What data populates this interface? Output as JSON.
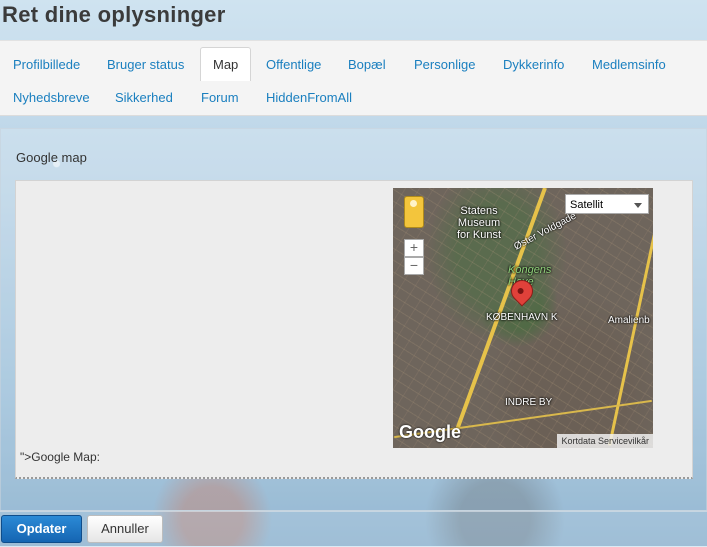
{
  "page": {
    "title": "Ret dine oplysninger"
  },
  "tabs": [
    {
      "label": "Profilbillede",
      "active": false
    },
    {
      "label": "Bruger status",
      "active": false
    },
    {
      "label": "Map",
      "active": true
    },
    {
      "label": "Offentlige",
      "active": false
    },
    {
      "label": "Bopæl",
      "active": false
    },
    {
      "label": "Personlige",
      "active": false
    },
    {
      "label": "Dykkerinfo",
      "active": false
    },
    {
      "label": "Medlemsinfo",
      "active": false
    },
    {
      "label": "Nyhedsbreve",
      "active": false
    },
    {
      "label": "Sikkerhed",
      "active": false
    },
    {
      "label": "Forum",
      "active": false
    },
    {
      "label": "HiddenFromAll",
      "active": false
    }
  ],
  "section": {
    "label": "Google map",
    "footer_text": "\">Google Map:"
  },
  "map": {
    "type_selected": "Satellit",
    "zoom_in": "+",
    "zoom_out": "−",
    "labels": {
      "museum": "Statens\nMuseum\nfor Kunst",
      "street": "Øster Voldgade",
      "park": "Kongens\nHave",
      "city": "KØBENHAVN K",
      "district": "INDRE BY",
      "amalien": "Amalienb"
    },
    "logo": "Google",
    "attribution": "Kortdata   Servicevilkår"
  },
  "buttons": {
    "submit": "Opdater",
    "cancel": "Annuller"
  },
  "colors": {
    "link": "#1a7fbf",
    "primary_button": "#1a74c4"
  }
}
